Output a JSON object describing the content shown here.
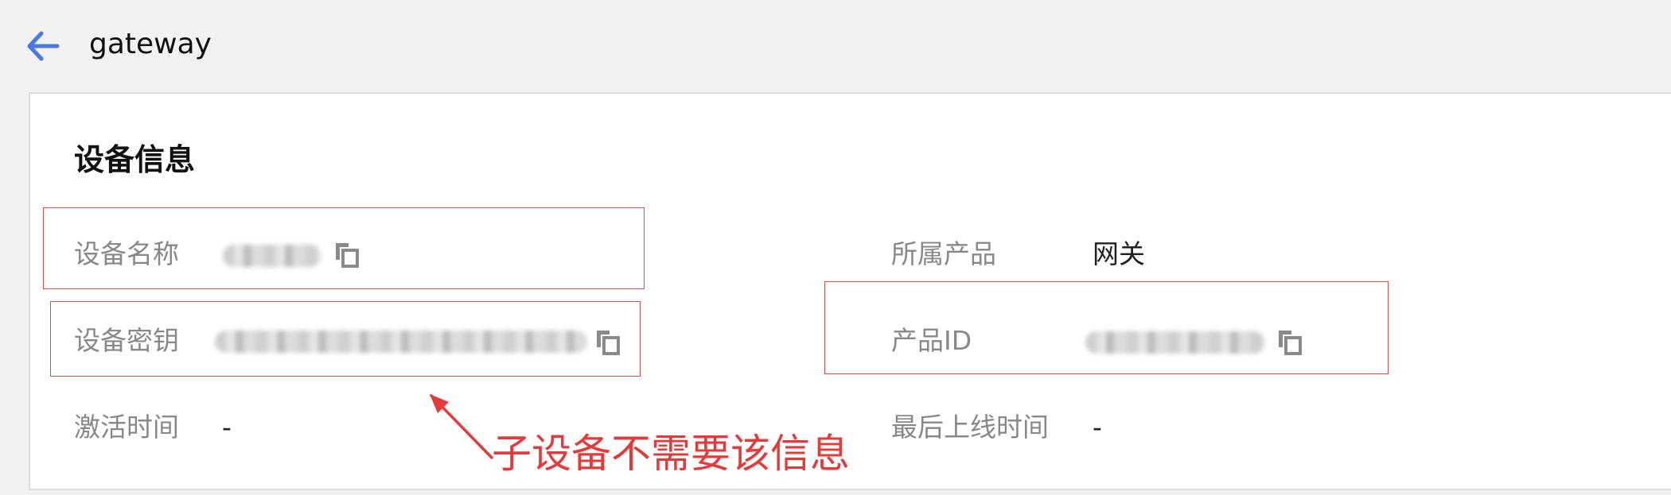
{
  "header": {
    "title": "gateway",
    "back_icon": "arrow-left-icon",
    "accent_color": "#4a78e8"
  },
  "section": {
    "title": "设备信息"
  },
  "fields": {
    "device_name": {
      "label": "设备名称"
    },
    "product": {
      "label": "所属产品",
      "value": "网关"
    },
    "device_secret": {
      "label": "设备密钥"
    },
    "product_id": {
      "label": "产品ID"
    },
    "activation_time": {
      "label": "激活时间",
      "value": "-"
    },
    "last_online_time": {
      "label": "最后上线时间",
      "value": "-"
    }
  },
  "annotation": {
    "text": "子设备不需要该信息",
    "color": "#e53a3a"
  },
  "icons": {
    "copy": "copy-icon"
  }
}
